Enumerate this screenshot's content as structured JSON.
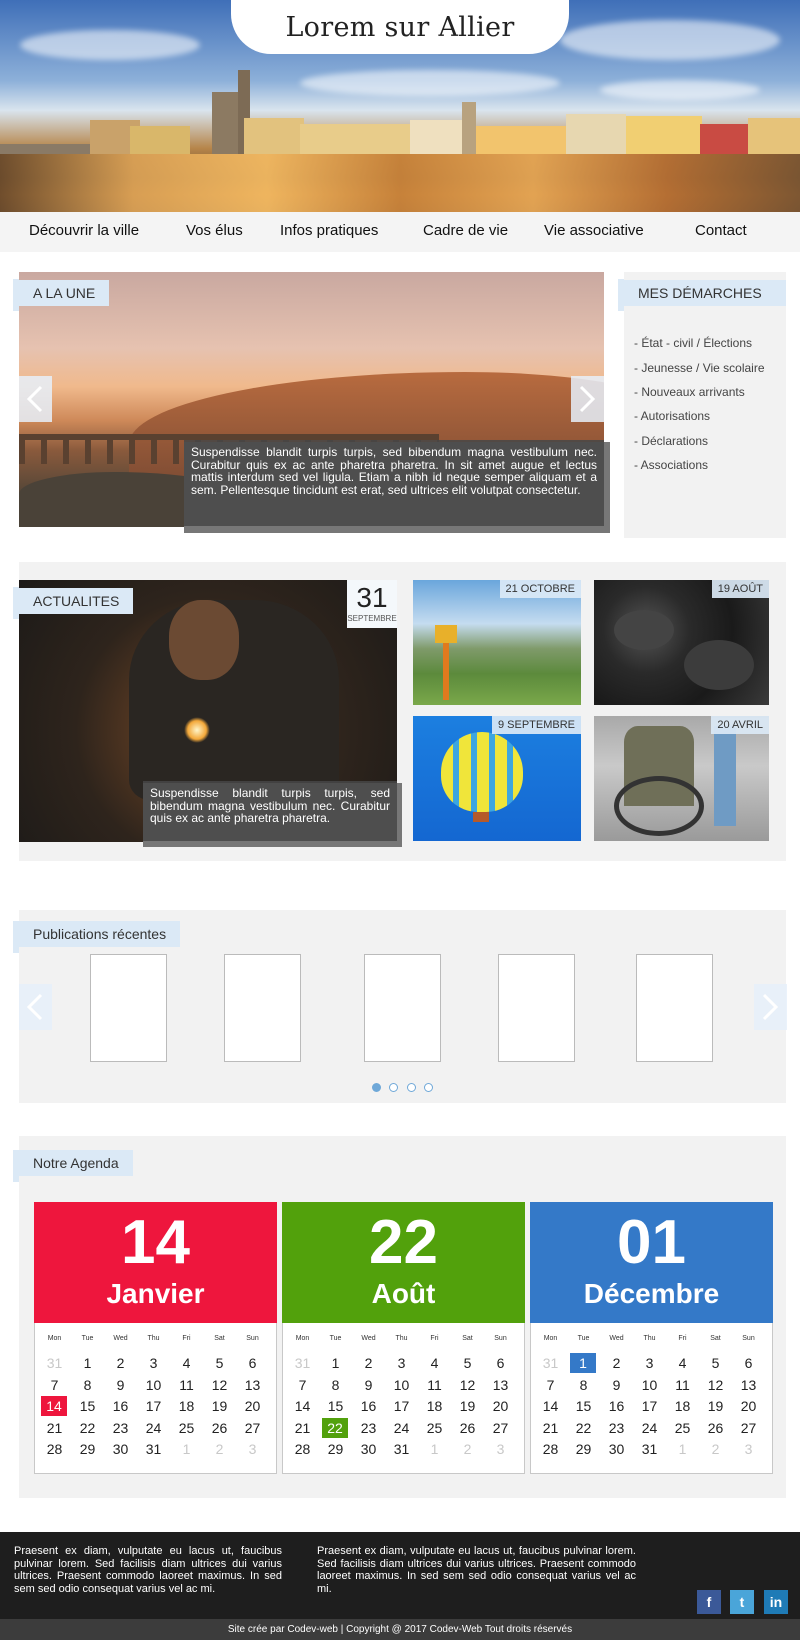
{
  "header": {
    "site_title": "Lorem sur Allier"
  },
  "nav": {
    "items": [
      "Découvrir la ville",
      "Vos élus",
      "Infos pratiques",
      "Cadre de vie",
      "Vie associative",
      "Contact"
    ]
  },
  "a_la_une": {
    "tag": "A LA UNE",
    "caption": "Suspendisse blandit turpis turpis, sed bibendum magna vestibulum nec. Curabitur quis ex ac ante pharetra pharetra. In sit amet augue et lectus mattis interdum sed vel ligula. Etiam a nibh id neque semper aliquam et a sem. Pellentesque tincidunt est erat, sed ultrices elit volutpat consectetur."
  },
  "demarches": {
    "title": "MES DÉMARCHES",
    "items": [
      "- État - civil / Élections",
      "- Jeunesse / Vie scolaire",
      "- Nouveaux arrivants",
      "- Autorisations",
      "- Déclarations",
      "- Associations"
    ]
  },
  "actualites": {
    "tag": "ACTUALITES",
    "featured": {
      "day": "31",
      "month": "SEPTEMBRE",
      "caption": "Suspendisse blandit turpis turpis, sed bibendum magna vestibulum nec. Curabitur quis ex ac ante pharetra pharetra."
    },
    "thumbs": [
      {
        "date": "21 OCTOBRE"
      },
      {
        "date": "19 AOÛT"
      },
      {
        "date": "9 SEPTEMBRE"
      },
      {
        "date": "20 AVRIL"
      }
    ]
  },
  "publications": {
    "tag": "Publications récentes"
  },
  "agenda": {
    "tag": "Notre Agenda",
    "weekdays": [
      "Mon",
      "Tue",
      "Wed",
      "Thu",
      "Fri",
      "Sat",
      "Sun"
    ],
    "calendars": [
      {
        "day": "14",
        "month": "Janvier",
        "color": "#ee163d",
        "rows": [
          [
            "31",
            "1",
            "2",
            "3",
            "4",
            "5",
            "6"
          ],
          [
            "7",
            "8",
            "9",
            "10",
            "11",
            "12",
            "13"
          ],
          [
            "14",
            "15",
            "16",
            "17",
            "18",
            "19",
            "20"
          ],
          [
            "21",
            "22",
            "23",
            "24",
            "25",
            "26",
            "27"
          ],
          [
            "28",
            "29",
            "30",
            "31",
            "1",
            "2",
            "3"
          ]
        ]
      },
      {
        "day": "22",
        "month": "Août",
        "color": "#52a10c",
        "rows": [
          [
            "31",
            "1",
            "2",
            "3",
            "4",
            "5",
            "6"
          ],
          [
            "7",
            "8",
            "9",
            "10",
            "11",
            "12",
            "13"
          ],
          [
            "14",
            "15",
            "16",
            "17",
            "18",
            "19",
            "20"
          ],
          [
            "21",
            "22",
            "23",
            "24",
            "25",
            "26",
            "27"
          ],
          [
            "28",
            "29",
            "30",
            "31",
            "1",
            "2",
            "3"
          ]
        ]
      },
      {
        "day": "01",
        "month": "Décembre",
        "color": "#3479c8",
        "rows": [
          [
            "31",
            "1",
            "2",
            "3",
            "4",
            "5",
            "6"
          ],
          [
            "7",
            "8",
            "9",
            "10",
            "11",
            "12",
            "13"
          ],
          [
            "14",
            "15",
            "16",
            "17",
            "18",
            "19",
            "20"
          ],
          [
            "21",
            "22",
            "23",
            "24",
            "25",
            "26",
            "27"
          ],
          [
            "28",
            "29",
            "30",
            "31",
            "1",
            "2",
            "3"
          ]
        ]
      }
    ]
  },
  "footer": {
    "text_left": "Praesent ex diam, vulputate eu lacus ut, faucibus pulvinar lorem. Sed facilisis diam ultrices dui varius ultrices. Praesent commodo laoreet maximus. In sed sem sed odio consequat varius vel ac mi.",
    "text_right": "Praesent ex diam, vulputate eu lacus ut, faucibus pulvinar lorem. Sed facilisis diam ultrices dui varius ultrices. Praesent commodo laoreet maximus. In sed sem sed odio consequat varius vel ac mi.",
    "social": [
      "facebook-icon",
      "twitter-icon",
      "linkedin-icon"
    ],
    "social_color": "#3b5998",
    "credits": "Site crée par Codev-web | Copyright @ 2017 Codev-Web Tout droits réservés"
  }
}
